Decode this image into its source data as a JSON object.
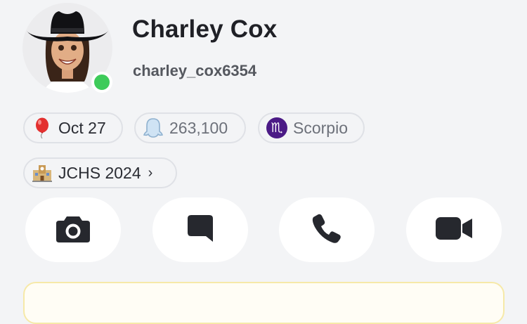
{
  "profile": {
    "display_name": "Charley Cox",
    "username": "charley_cox6354",
    "online": true
  },
  "chips": {
    "birthday": {
      "icon": "balloon-icon",
      "label": "Oct 27"
    },
    "snap_score": {
      "icon": "ghost-icon",
      "label": "263,100"
    },
    "zodiac": {
      "icon": "scorpio-icon",
      "symbol": "♏",
      "label": "Scorpio"
    },
    "school": {
      "icon": "school-icon",
      "label": "JCHS 2024",
      "chevron": "›"
    }
  },
  "actions": [
    {
      "name": "camera",
      "icon": "camera-icon"
    },
    {
      "name": "chat",
      "icon": "chat-icon"
    },
    {
      "name": "call",
      "icon": "phone-icon"
    },
    {
      "name": "video",
      "icon": "video-camera-icon"
    }
  ],
  "colors": {
    "background": "#f3f4f6",
    "online": "#3ecb5a",
    "scorpio": "#4b1a86",
    "action_icon": "#26282e",
    "card_border": "#f6e9a8"
  }
}
